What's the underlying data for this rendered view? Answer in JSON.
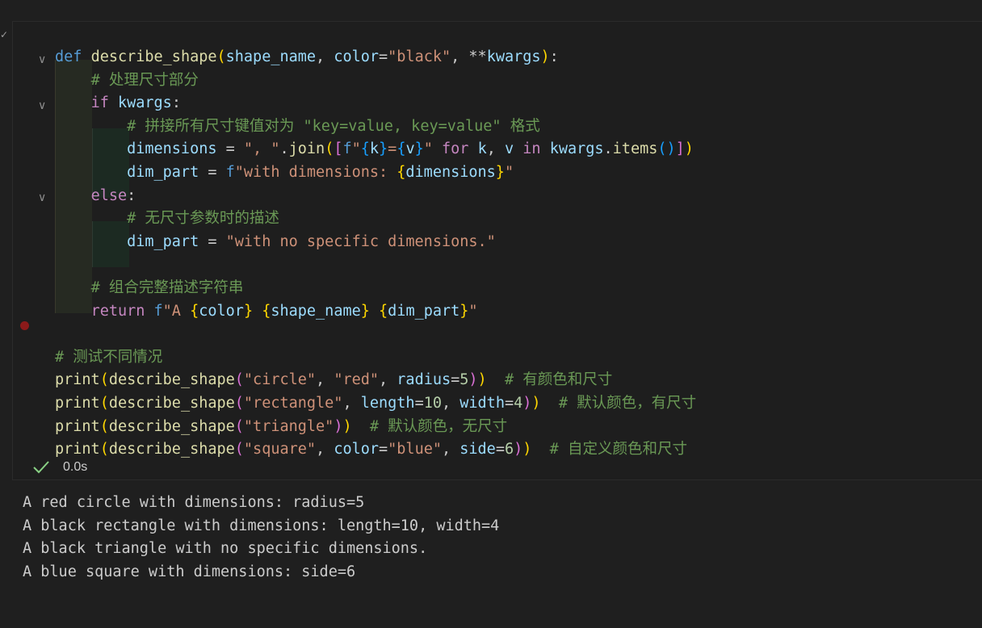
{
  "cell": {
    "code_lines": [
      {
        "tokens": [
          [
            "kw",
            "def"
          ],
          [
            "df",
            " "
          ],
          [
            "fn",
            "describe_shape"
          ],
          [
            "b1",
            "("
          ],
          [
            "pm",
            "shape_name"
          ],
          [
            "df",
            ", "
          ],
          [
            "pm",
            "color"
          ],
          [
            "df",
            "="
          ],
          [
            "st",
            "\"black\""
          ],
          [
            "df",
            ", **"
          ],
          [
            "pm",
            "kwargs"
          ],
          [
            "b1",
            ")"
          ],
          [
            "df",
            ":"
          ]
        ]
      },
      {
        "tokens": [
          [
            "df",
            "    "
          ],
          [
            "cm",
            "# 处理尺寸部分"
          ]
        ]
      },
      {
        "tokens": [
          [
            "df",
            "    "
          ],
          [
            "ctl",
            "if"
          ],
          [
            "df",
            " "
          ],
          [
            "pm",
            "kwargs"
          ],
          [
            "df",
            ":"
          ]
        ]
      },
      {
        "tokens": [
          [
            "df",
            "        "
          ],
          [
            "cm",
            "# 拼接所有尺寸键值对为 \"key=value, key=value\" 格式"
          ]
        ]
      },
      {
        "tokens": [
          [
            "df",
            "        "
          ],
          [
            "pm",
            "dimensions"
          ],
          [
            "df",
            " = "
          ],
          [
            "st",
            "\", \""
          ],
          [
            "df",
            "."
          ],
          [
            "fn",
            "join"
          ],
          [
            "b1",
            "("
          ],
          [
            "b2",
            "["
          ],
          [
            "kw",
            "f"
          ],
          [
            "st",
            "\""
          ],
          [
            "b3",
            "{"
          ],
          [
            "pm",
            "k"
          ],
          [
            "b3",
            "}"
          ],
          [
            "st",
            "="
          ],
          [
            "b3",
            "{"
          ],
          [
            "pm",
            "v"
          ],
          [
            "b3",
            "}"
          ],
          [
            "st",
            "\""
          ],
          [
            "df",
            " "
          ],
          [
            "ctl",
            "for"
          ],
          [
            "df",
            " "
          ],
          [
            "pm",
            "k"
          ],
          [
            "df",
            ", "
          ],
          [
            "pm",
            "v"
          ],
          [
            "df",
            " "
          ],
          [
            "ctl",
            "in"
          ],
          [
            "df",
            " "
          ],
          [
            "pm",
            "kwargs"
          ],
          [
            "df",
            "."
          ],
          [
            "fn",
            "items"
          ],
          [
            "b3",
            "()"
          ],
          [
            "b2",
            "]"
          ],
          [
            "b1",
            ")"
          ]
        ]
      },
      {
        "tokens": [
          [
            "df",
            "        "
          ],
          [
            "pm",
            "dim_part"
          ],
          [
            "df",
            " = "
          ],
          [
            "kw",
            "f"
          ],
          [
            "st",
            "\"with dimensions: "
          ],
          [
            "b1",
            "{"
          ],
          [
            "pm",
            "dimensions"
          ],
          [
            "b1",
            "}"
          ],
          [
            "st",
            "\""
          ]
        ]
      },
      {
        "tokens": [
          [
            "df",
            "    "
          ],
          [
            "ctl",
            "else"
          ],
          [
            "df",
            ":"
          ]
        ]
      },
      {
        "tokens": [
          [
            "df",
            "        "
          ],
          [
            "cm",
            "# 无尺寸参数时的描述"
          ]
        ]
      },
      {
        "tokens": [
          [
            "df",
            "        "
          ],
          [
            "pm",
            "dim_part"
          ],
          [
            "df",
            " = "
          ],
          [
            "st",
            "\"with no specific dimensions.\""
          ]
        ]
      },
      {
        "tokens": []
      },
      {
        "tokens": [
          [
            "df",
            "    "
          ],
          [
            "cm",
            "# 组合完整描述字符串"
          ]
        ]
      },
      {
        "tokens": [
          [
            "df",
            "    "
          ],
          [
            "ctl",
            "return"
          ],
          [
            "df",
            " "
          ],
          [
            "kw",
            "f"
          ],
          [
            "st",
            "\"A "
          ],
          [
            "b1",
            "{"
          ],
          [
            "pm",
            "color"
          ],
          [
            "b1",
            "}"
          ],
          [
            "st",
            " "
          ],
          [
            "b1",
            "{"
          ],
          [
            "pm",
            "shape_name"
          ],
          [
            "b1",
            "}"
          ],
          [
            "st",
            " "
          ],
          [
            "b1",
            "{"
          ],
          [
            "pm",
            "dim_part"
          ],
          [
            "b1",
            "}"
          ],
          [
            "st",
            "\""
          ]
        ]
      },
      {
        "tokens": []
      },
      {
        "tokens": [
          [
            "cm",
            "# 测试不同情况"
          ]
        ]
      },
      {
        "tokens": [
          [
            "fn",
            "print"
          ],
          [
            "b1",
            "("
          ],
          [
            "fn",
            "describe_shape"
          ],
          [
            "b2",
            "("
          ],
          [
            "st",
            "\"circle\""
          ],
          [
            "df",
            ", "
          ],
          [
            "st",
            "\"red\""
          ],
          [
            "df",
            ", "
          ],
          [
            "pm",
            "radius"
          ],
          [
            "df",
            "="
          ],
          [
            "nm",
            "5"
          ],
          [
            "b2",
            ")"
          ],
          [
            "b1",
            ")"
          ],
          [
            "df",
            "  "
          ],
          [
            "cm",
            "# 有颜色和尺寸"
          ]
        ]
      },
      {
        "tokens": [
          [
            "fn",
            "print"
          ],
          [
            "b1",
            "("
          ],
          [
            "fn",
            "describe_shape"
          ],
          [
            "b2",
            "("
          ],
          [
            "st",
            "\"rectangle\""
          ],
          [
            "df",
            ", "
          ],
          [
            "pm",
            "length"
          ],
          [
            "df",
            "="
          ],
          [
            "nm",
            "10"
          ],
          [
            "df",
            ", "
          ],
          [
            "pm",
            "width"
          ],
          [
            "df",
            "="
          ],
          [
            "nm",
            "4"
          ],
          [
            "b2",
            ")"
          ],
          [
            "b1",
            ")"
          ],
          [
            "df",
            "  "
          ],
          [
            "cm",
            "# 默认颜色，有尺寸"
          ]
        ]
      },
      {
        "tokens": [
          [
            "fn",
            "print"
          ],
          [
            "b1",
            "("
          ],
          [
            "fn",
            "describe_shape"
          ],
          [
            "b2",
            "("
          ],
          [
            "st",
            "\"triangle\""
          ],
          [
            "b2",
            ")"
          ],
          [
            "b1",
            ")"
          ],
          [
            "df",
            "  "
          ],
          [
            "cm",
            "# 默认颜色，无尺寸"
          ]
        ]
      },
      {
        "tokens": [
          [
            "fn",
            "print"
          ],
          [
            "b1",
            "("
          ],
          [
            "fn",
            "describe_shape"
          ],
          [
            "b2",
            "("
          ],
          [
            "st",
            "\"square\""
          ],
          [
            "df",
            ", "
          ],
          [
            "pm",
            "color"
          ],
          [
            "df",
            "="
          ],
          [
            "st",
            "\"blue\""
          ],
          [
            "df",
            ", "
          ],
          [
            "pm",
            "side"
          ],
          [
            "df",
            "="
          ],
          [
            "nm",
            "6"
          ],
          [
            "b2",
            ")"
          ],
          [
            "b1",
            ")"
          ],
          [
            "df",
            "  "
          ],
          [
            "cm",
            "# 自定义颜色和尺寸"
          ]
        ]
      }
    ],
    "execution_time": "0.0s",
    "status_icon": "check-icon"
  },
  "output": {
    "lines": [
      "A red circle with dimensions: radius=5",
      "A black rectangle with dimensions: length=10, width=4",
      "A black triangle with no specific dimensions.",
      "A blue square with dimensions: side=6"
    ]
  },
  "colors": {
    "background": "#1f1f1f",
    "keyword": "#569cd6",
    "control": "#c586c0",
    "function": "#dcdcaa",
    "parameter": "#9cdcfe",
    "string": "#ce9178",
    "comment": "#6a9955",
    "number": "#b5cea8",
    "success": "#89d185",
    "breakpoint": "#8b1a1a"
  }
}
